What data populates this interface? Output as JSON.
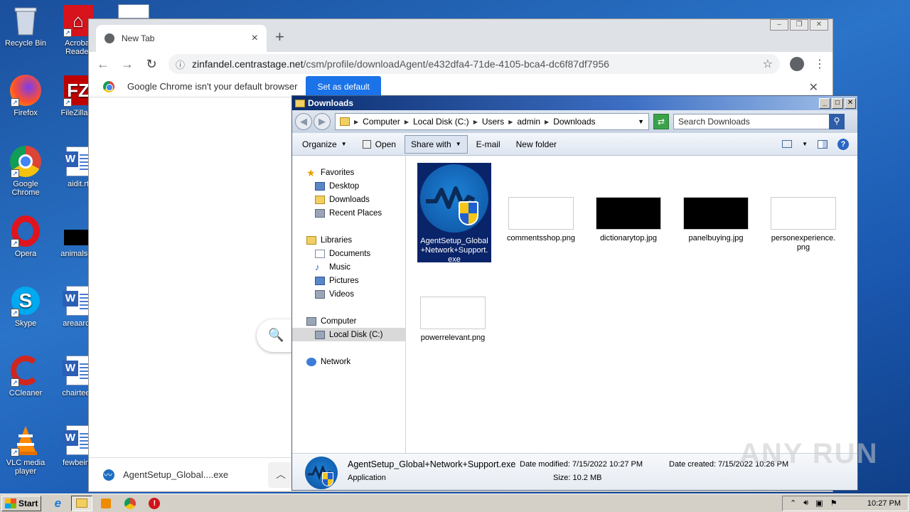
{
  "desktop": {
    "icons": [
      {
        "label": "Recycle Bin",
        "icon": "recycle-bin-icon"
      },
      {
        "label": "Acrobat Reader",
        "icon": "acrobat-icon"
      },
      {
        "label": "Firefox",
        "icon": "firefox-icon"
      },
      {
        "label": "FileZilla C",
        "icon": "filezilla-icon"
      },
      {
        "label": "Google Chrome",
        "icon": "chrome-icon"
      },
      {
        "label": "aidit.rt",
        "icon": "word-doc-icon"
      },
      {
        "label": "Opera",
        "icon": "opera-icon"
      },
      {
        "label": "animalsec",
        "icon": "black-file-icon"
      },
      {
        "label": "Skype",
        "icon": "skype-icon"
      },
      {
        "label": "areaarch",
        "icon": "word-doc-icon"
      },
      {
        "label": "CCleaner",
        "icon": "ccleaner-icon"
      },
      {
        "label": "chairteen",
        "icon": "word-doc-icon"
      },
      {
        "label": "VLC media player",
        "icon": "vlc-icon"
      },
      {
        "label": "fewbeing",
        "icon": "word-doc-icon"
      }
    ]
  },
  "chrome": {
    "tab_title": "New Tab",
    "tab_close": "×",
    "new_tab": "+",
    "url_host": "zinfandel.centrastage.net",
    "url_path": "/csm/profile/downloadAgent/e432dfa4-71de-4105-bca4-dc6f87df7956",
    "infobar_text": "Google Chrome isn't your default browser",
    "set_default_label": "Set as default",
    "download_filename": "AgentSetup_Global....exe"
  },
  "explorer": {
    "title": "Downloads",
    "breadcrumb": [
      "Computer",
      "Local Disk (C:)",
      "Users",
      "admin",
      "Downloads"
    ],
    "search_placeholder": "Search Downloads",
    "commands": {
      "organize": "Organize",
      "open": "Open",
      "share_with": "Share with",
      "email": "E-mail",
      "new_folder": "New folder"
    },
    "nav": {
      "favorites": "Favorites",
      "desktop": "Desktop",
      "downloads": "Downloads",
      "recent_places": "Recent Places",
      "libraries": "Libraries",
      "documents": "Documents",
      "music": "Music",
      "pictures": "Pictures",
      "videos": "Videos",
      "computer": "Computer",
      "local_disk": "Local Disk (C:)",
      "network": "Network"
    },
    "files": {
      "agent": "AgentSetup_Global+Network+Support.exe",
      "commentsshop": "commentsshop.png",
      "dictionarytop": "dictionarytop.jpg",
      "panelbuying": "panelbuying.jpg",
      "personexperience": "personexperience.png",
      "powerrelevant": "powerrelevant.png"
    },
    "details": {
      "name": "AgentSetup_Global+Network+Support.exe",
      "type": "Application",
      "date_modified": "Date modified: 7/15/2022 10:27 PM",
      "size": "Size: 10.2 MB",
      "date_created": "Date created: 7/15/2022 10:26 PM"
    }
  },
  "taskbar": {
    "start_label": "Start",
    "clock": "10:27 PM"
  },
  "watermark": "ANY RUN",
  "colors": {
    "selection": "#0a246a",
    "chrome_blue": "#1a73e8",
    "desktop_blue": "#2a74c9"
  }
}
